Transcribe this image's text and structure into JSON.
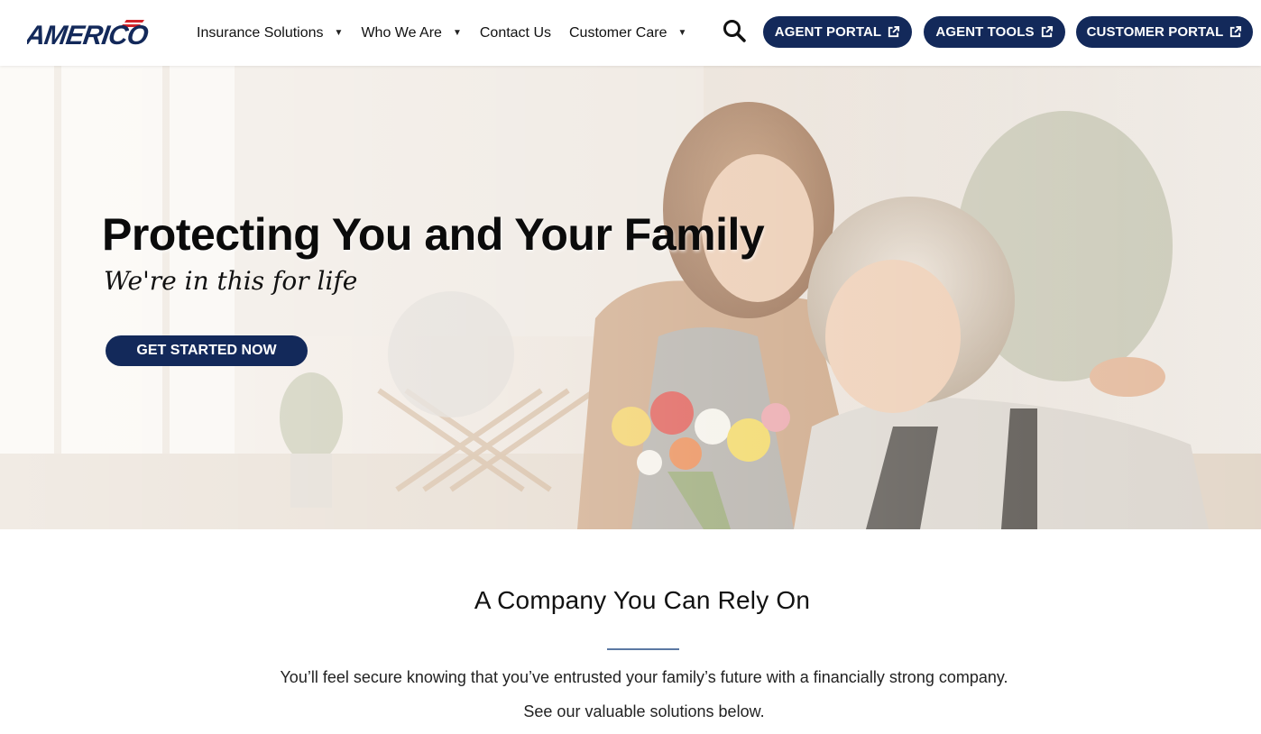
{
  "header": {
    "logo_text": "AMERICO",
    "nav": [
      {
        "label": "Insurance Solutions",
        "has_dropdown": true
      },
      {
        "label": "Who We Are",
        "has_dropdown": true
      },
      {
        "label": "Contact Us",
        "has_dropdown": false
      },
      {
        "label": "Customer Care",
        "has_dropdown": true
      }
    ],
    "search_icon": "search-icon",
    "portal_buttons": [
      {
        "label": "AGENT PORTAL",
        "icon": "external-link-icon"
      },
      {
        "label": "AGENT TOOLS",
        "icon": "external-link-icon"
      },
      {
        "label": "CUSTOMER PORTAL",
        "icon": "external-link-icon"
      }
    ]
  },
  "hero": {
    "title": "Protecting You and Your Family",
    "subtitle": "We're in this for life",
    "cta_label": "GET STARTED NOW"
  },
  "intro": {
    "heading": "A Company You Can Rely On",
    "paragraph1": "You’ll feel secure knowing that you’ve entrusted your family’s future with a financially strong company.",
    "paragraph2": "See our valuable solutions below."
  },
  "colors": {
    "brand_navy": "#13295a",
    "logo_red": "#d2232a",
    "divider_blue": "#5b78a3"
  }
}
